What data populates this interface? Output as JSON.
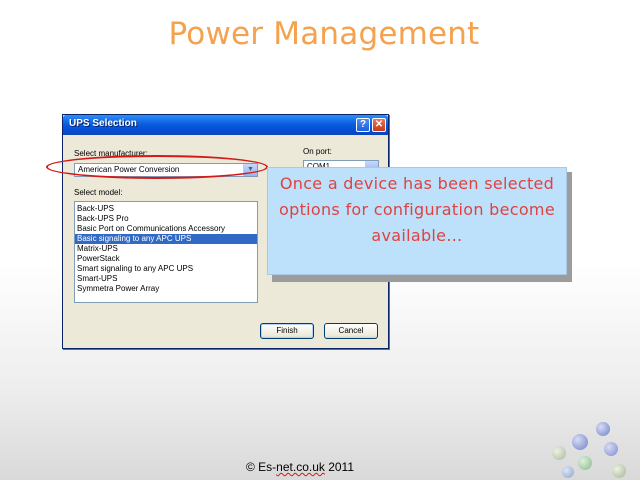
{
  "slide": {
    "title": "Power Management",
    "callout": "Once a device has been selected options for configuration become available…",
    "footer_prefix": "© Es-",
    "footer_squiggle": "net.co.uk",
    "footer_suffix": " 2011"
  },
  "dialog": {
    "title": "UPS Selection",
    "help_label": "?",
    "close_label": "✕",
    "manufacturer_label": "Select manufacturer:",
    "manufacturer_value": "American Power Conversion",
    "port_label": "On port:",
    "port_value": "COM1",
    "model_label": "Select model:",
    "models": [
      "Back-UPS",
      "Back-UPS Pro",
      "Basic Port on Communications Accessory",
      "Basic signaling to any APC UPS",
      "Matrix-UPS",
      "PowerStack",
      "Smart signaling to any APC UPS",
      "Smart-UPS",
      "Symmetra Power Array"
    ],
    "selected_model": "Basic signaling to any APC UPS",
    "finish_label": "Finish",
    "cancel_label": "Cancel"
  },
  "colors": {
    "title": "#f5a24f",
    "callout_text": "#e0423f",
    "callout_bg": "#bde0fb",
    "highlight_oval": "#d21a1a",
    "selection": "#316ac5"
  }
}
